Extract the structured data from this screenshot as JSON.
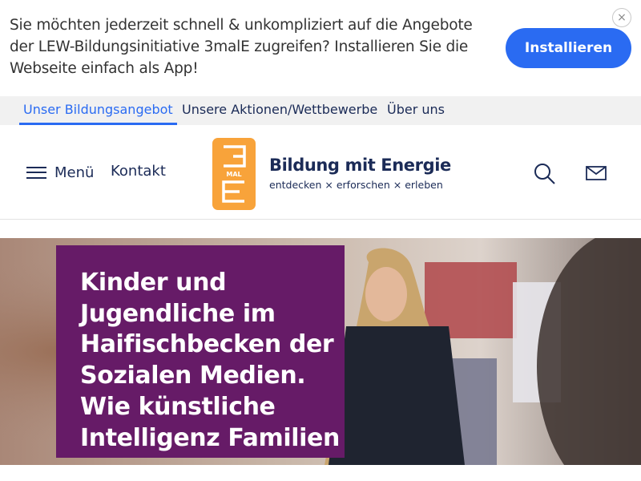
{
  "banner": {
    "text": "Sie möchten jederzeit schnell & unkompliziert auf die Angebote der LEW-Bildungsinitiative 3malE zugreifen? Installieren Sie die Webseite einfach als App!",
    "install_label": "Installieren",
    "close_label": "×"
  },
  "topnav": {
    "tabs": [
      {
        "label": "Unser Bildungsangebot",
        "active": true
      },
      {
        "label": "Unsere Aktionen/Wettbewerbe",
        "active": false
      },
      {
        "label": "Über uns",
        "active": false
      }
    ]
  },
  "header": {
    "menu_label": "Menü",
    "contact_label": "Kontakt",
    "logo": {
      "mark_top": "3",
      "mark_mid": "MAL",
      "mark_bottom": "E",
      "title": "Bildung mit Energie",
      "subtitle": "entdecken × erforschen × erleben"
    },
    "icons": [
      "search-icon",
      "mail-icon"
    ]
  },
  "hero": {
    "title": "Kinder und Jugendliche im Haifischbecken der Sozialen Medien. Wie künstliche Intelligenz Familien"
  },
  "colors": {
    "accent": "#2a6bf2",
    "brand_orange": "#f8a33a",
    "hero_box": "#661b67",
    "nav_text": "#1b2b57"
  }
}
